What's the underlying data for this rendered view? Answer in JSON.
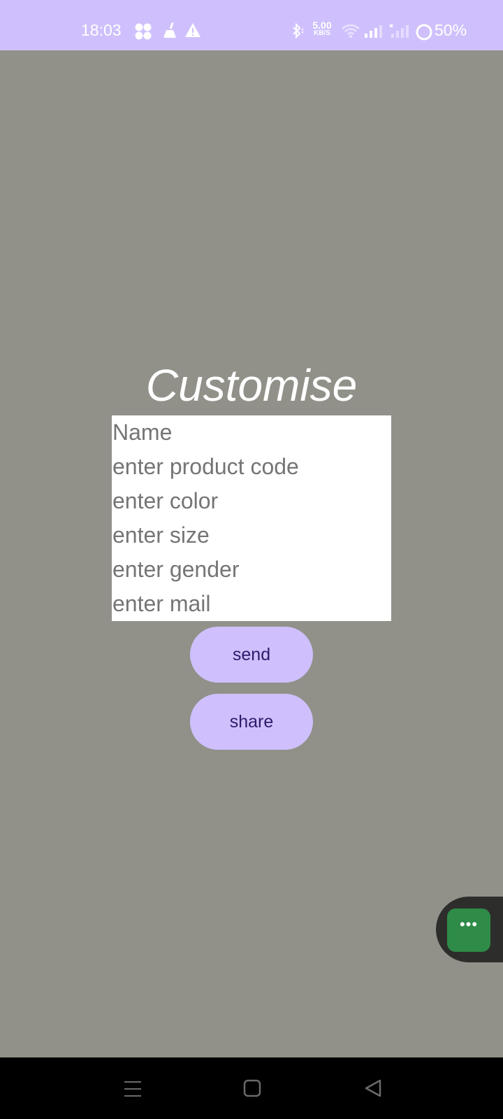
{
  "status_bar": {
    "time": "18:03",
    "network_speed_value": "5.00",
    "network_speed_unit": "KB/S",
    "battery": "50%",
    "icons_left": [
      "fan-icon",
      "broom-icon",
      "warning-icon"
    ],
    "icons_right": [
      "bluetooth-icon",
      "wifi-icon",
      "signal-icon",
      "signal-no-service-icon",
      "battery-ring-icon"
    ]
  },
  "screen": {
    "title": "Customise"
  },
  "form": {
    "name_placeholder": "Name",
    "product_code_placeholder": "enter product code",
    "color_placeholder": "enter color",
    "size_placeholder": "enter size",
    "gender_placeholder": "enter gender",
    "mail_placeholder": "enter mail"
  },
  "actions": {
    "send_label": "send",
    "share_label": "share"
  },
  "floating_button": {
    "label": "•••"
  },
  "nav": {
    "icons": [
      "menu-icon",
      "home-icon",
      "back-icon"
    ]
  },
  "colors": {
    "status_bar_bg": "#cfc0fd",
    "background": "#91918a",
    "button_bg": "#cfc0fd",
    "button_text": "#2f1a6b",
    "fab_green": "#2e8b48"
  }
}
